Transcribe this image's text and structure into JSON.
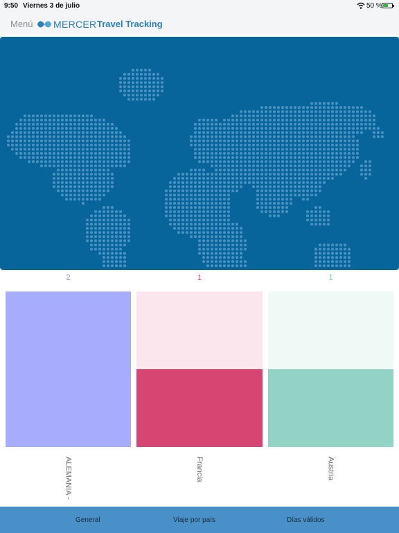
{
  "status_bar": {
    "time": "9:50",
    "date": "Viernes 3 de julio",
    "battery": "50 %",
    "wifi_icon": "wifi-icon",
    "battery_icon": "battery-charging-icon"
  },
  "nav": {
    "menu_label": "Menú",
    "logo_text": "MERCER",
    "title": "Travel Tracking"
  },
  "colors": {
    "map_bg": "#08659b",
    "map_dots": "#4a93c1",
    "accent": "#2c7fb9",
    "tabbar": "#4a90c8"
  },
  "chart_data": {
    "type": "bar",
    "categories": [
      "ALEMANIA -",
      "Francia",
      "Austria"
    ],
    "values": [
      2,
      1,
      1
    ],
    "ylim": [
      0,
      2
    ],
    "colors": {
      "fill": [
        "#a8acfc",
        "#d74573",
        "#93d3c6"
      ],
      "background": [
        "#a8acfc",
        "#fae6ec",
        "#effaf6"
      ],
      "count_text": [
        "#8d90e8",
        "#d74573",
        "#79c8b6"
      ]
    }
  },
  "tabbar": {
    "tabs": [
      {
        "label": "General"
      },
      {
        "label": "Viaje por país"
      },
      {
        "label": "Días válidos"
      }
    ]
  }
}
